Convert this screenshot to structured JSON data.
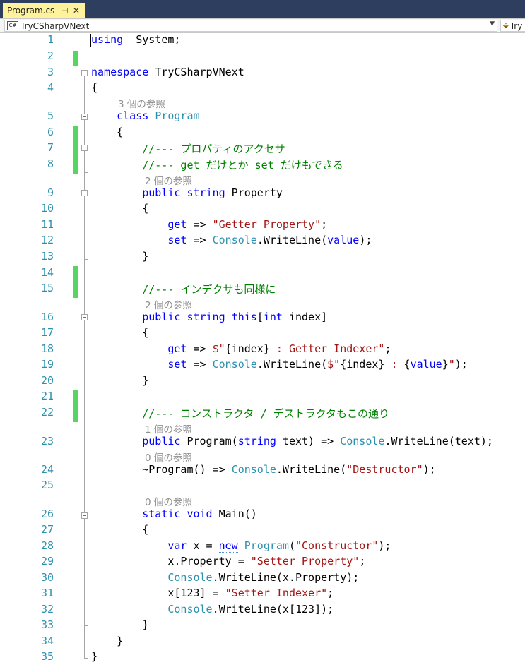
{
  "tab": {
    "title": "Program.cs",
    "pin_glyph": "⊣",
    "close_glyph": "✕"
  },
  "navbar": {
    "namespace_label": "TryCSharpVNext",
    "cs_badge": "C#",
    "member_label": "Try"
  },
  "lines": [
    {
      "n": "1",
      "tokens": [
        [
          "kw",
          "using"
        ],
        [
          "",
          "  System;"
        ]
      ]
    },
    {
      "n": "2",
      "tokens": []
    },
    {
      "n": "3",
      "tokens": [
        [
          "kw",
          "namespace"
        ],
        [
          "",
          " TryCSharpVNext"
        ]
      ]
    },
    {
      "n": "4",
      "tokens": [
        [
          "",
          "{"
        ]
      ]
    },
    {
      "n": "5",
      "tokens": [
        [
          "",
          "    "
        ],
        [
          "kw",
          "class"
        ],
        [
          "",
          " "
        ],
        [
          "ty",
          "Program"
        ]
      ]
    },
    {
      "n": "6",
      "tokens": [
        [
          "",
          "    {"
        ]
      ]
    },
    {
      "n": "7",
      "tokens": [
        [
          "",
          "        "
        ],
        [
          "cm",
          "//--- プロパティのアクセサ"
        ]
      ]
    },
    {
      "n": "8",
      "tokens": [
        [
          "",
          "        "
        ],
        [
          "cm",
          "//--- get だけとか set だけもできる"
        ]
      ]
    },
    {
      "n": "9",
      "tokens": [
        [
          "",
          "        "
        ],
        [
          "kw",
          "public"
        ],
        [
          "",
          " "
        ],
        [
          "kw",
          "string"
        ],
        [
          "",
          " Property"
        ]
      ]
    },
    {
      "n": "10",
      "tokens": [
        [
          "",
          "        {"
        ]
      ]
    },
    {
      "n": "11",
      "tokens": [
        [
          "",
          "            "
        ],
        [
          "kw",
          "get"
        ],
        [
          "",
          " => "
        ],
        [
          "st",
          "\"Getter Property\""
        ],
        [
          "",
          ";"
        ]
      ]
    },
    {
      "n": "12",
      "tokens": [
        [
          "",
          "            "
        ],
        [
          "kw",
          "set"
        ],
        [
          "",
          " => "
        ],
        [
          "ty",
          "Console"
        ],
        [
          "",
          ".WriteLine("
        ],
        [
          "kw",
          "value"
        ],
        [
          "",
          ");"
        ]
      ]
    },
    {
      "n": "13",
      "tokens": [
        [
          "",
          "        }"
        ]
      ]
    },
    {
      "n": "14",
      "tokens": []
    },
    {
      "n": "15",
      "tokens": [
        [
          "",
          "        "
        ],
        [
          "cm",
          "//--- インデクサも同様に"
        ]
      ]
    },
    {
      "n": "16",
      "tokens": [
        [
          "",
          "        "
        ],
        [
          "kw",
          "public"
        ],
        [
          "",
          " "
        ],
        [
          "kw",
          "string"
        ],
        [
          "",
          " "
        ],
        [
          "kw",
          "this"
        ],
        [
          "",
          "["
        ],
        [
          "kw",
          "int"
        ],
        [
          "",
          " index]"
        ]
      ]
    },
    {
      "n": "17",
      "tokens": [
        [
          "",
          "        {"
        ]
      ]
    },
    {
      "n": "18",
      "tokens": [
        [
          "",
          "            "
        ],
        [
          "kw",
          "get"
        ],
        [
          "",
          " => "
        ],
        [
          "st",
          "$\""
        ],
        [
          "",
          "{index}"
        ],
        [
          "st",
          " : Getter Indexer\""
        ],
        [
          "",
          ";"
        ]
      ]
    },
    {
      "n": "19",
      "tokens": [
        [
          "",
          "            "
        ],
        [
          "kw",
          "set"
        ],
        [
          "",
          " => "
        ],
        [
          "ty",
          "Console"
        ],
        [
          "",
          ".WriteLine("
        ],
        [
          "st",
          "$\""
        ],
        [
          "",
          "{index}"
        ],
        [
          "st",
          " : "
        ],
        [
          "",
          "{"
        ],
        [
          "kw",
          "value"
        ],
        [
          "",
          "}"
        ],
        [
          "st",
          "\""
        ],
        [
          "",
          ");"
        ]
      ]
    },
    {
      "n": "20",
      "tokens": [
        [
          "",
          "        }"
        ]
      ]
    },
    {
      "n": "21",
      "tokens": []
    },
    {
      "n": "22",
      "tokens": [
        [
          "",
          "        "
        ],
        [
          "cm",
          "//--- コンストラクタ / デストラクタもこの通り"
        ]
      ]
    },
    {
      "n": "23",
      "tokens": [
        [
          "",
          "        "
        ],
        [
          "kw",
          "public"
        ],
        [
          "",
          " Program("
        ],
        [
          "kw",
          "string"
        ],
        [
          "",
          " text) => "
        ],
        [
          "ty",
          "Console"
        ],
        [
          "",
          ".WriteLine(text);"
        ]
      ]
    },
    {
      "n": "24",
      "tokens": [
        [
          "",
          "        ~Program() => "
        ],
        [
          "ty",
          "Console"
        ],
        [
          "",
          ".WriteLine("
        ],
        [
          "st",
          "\"Destructor\""
        ],
        [
          "",
          ");"
        ]
      ]
    },
    {
      "n": "25",
      "tokens": []
    },
    {
      "n": "26",
      "tokens": [
        [
          "",
          "        "
        ],
        [
          "kw",
          "static"
        ],
        [
          "",
          " "
        ],
        [
          "kw",
          "void"
        ],
        [
          "",
          " Main()"
        ]
      ]
    },
    {
      "n": "27",
      "tokens": [
        [
          "",
          "        {"
        ]
      ]
    },
    {
      "n": "28",
      "tokens": [
        [
          "",
          "            "
        ],
        [
          "kw",
          "var"
        ],
        [
          "",
          " x = "
        ],
        [
          "kw",
          "new"
        ],
        [
          "",
          " "
        ],
        [
          "ty",
          "Program"
        ],
        [
          "",
          "("
        ],
        [
          "st",
          "\"Constructor\""
        ],
        [
          "",
          ");"
        ]
      ]
    },
    {
      "n": "29",
      "tokens": [
        [
          "",
          "            x.Property = "
        ],
        [
          "st",
          "\"Setter Property\""
        ],
        [
          "",
          ";"
        ]
      ]
    },
    {
      "n": "30",
      "tokens": [
        [
          "",
          "            "
        ],
        [
          "ty",
          "Console"
        ],
        [
          "",
          ".WriteLine(x.Property);"
        ]
      ]
    },
    {
      "n": "31",
      "tokens": [
        [
          "",
          "            x[123] = "
        ],
        [
          "st",
          "\"Setter Indexer\""
        ],
        [
          "",
          ";"
        ]
      ]
    },
    {
      "n": "32",
      "tokens": [
        [
          "",
          "            "
        ],
        [
          "ty",
          "Console"
        ],
        [
          "",
          ".WriteLine(x[123]);"
        ]
      ]
    },
    {
      "n": "33",
      "tokens": [
        [
          "",
          "        }"
        ]
      ]
    },
    {
      "n": "34",
      "tokens": [
        [
          "",
          "    }"
        ]
      ]
    },
    {
      "n": "35",
      "tokens": [
        [
          "",
          "}"
        ]
      ]
    }
  ],
  "codelens": {
    "class_program": "3 個の参照",
    "property": "2 個の参照",
    "indexer": "2 個の参照",
    "constructor": "1 個の参照",
    "destructor": "0 個の参照",
    "main": "0 個の参照"
  },
  "colors": {
    "keyword": "#0000ff",
    "type": "#2b91af",
    "string": "#a31515",
    "comment": "#008000",
    "line_number": "#2b91af",
    "changebar": "#57d563",
    "tab": "#fff29d",
    "titlebar": "#2d3e5f"
  }
}
